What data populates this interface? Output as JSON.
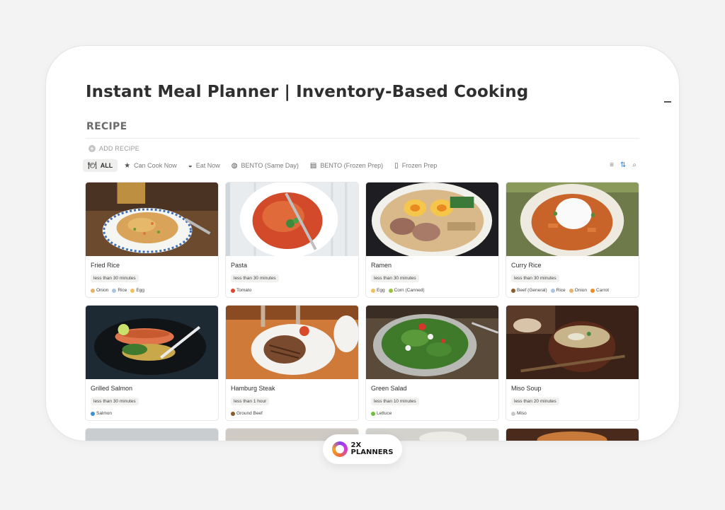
{
  "header": {
    "title": "Instant Meal Planner | Inventory-Based Cooking",
    "section": "RECIPE",
    "add_label": "ADD RECIPE"
  },
  "tabs": [
    {
      "label": "ALL",
      "icon": "utensils-icon",
      "active": true
    },
    {
      "label": "Can Cook Now",
      "icon": "star-icon",
      "active": false
    },
    {
      "label": "Eat Now",
      "icon": "bowl-icon",
      "active": false
    },
    {
      "label": "BENTO (Same Day)",
      "icon": "bento-icon",
      "active": false
    },
    {
      "label": "BENTO (Frozen Prep)",
      "icon": "box-icon",
      "active": false
    },
    {
      "label": "Frozen Prep",
      "icon": "freezer-icon",
      "active": false
    }
  ],
  "tools": [
    "filter-icon",
    "sort-icon",
    "search-icon"
  ],
  "recipes": [
    {
      "name": "Fried Rice",
      "time": "less than 30 minutes",
      "ingredients": [
        {
          "label": "Onion",
          "color": "#e8b26a"
        },
        {
          "label": "Rice",
          "color": "#a9c5e0"
        },
        {
          "label": "Egg",
          "color": "#f0c060"
        }
      ]
    },
    {
      "name": "Pasta",
      "time": "less than 30 minutes",
      "ingredients": [
        {
          "label": "Tomato",
          "color": "#e0432f"
        }
      ]
    },
    {
      "name": "Ramen",
      "time": "less than 30 minutes",
      "ingredients": [
        {
          "label": "Egg",
          "color": "#f0c060"
        },
        {
          "label": "Corn (Canned)",
          "color": "#9bc23b"
        }
      ]
    },
    {
      "name": "Curry Rice",
      "time": "less than 30 minutes",
      "ingredients": [
        {
          "label": "Beef (General)",
          "color": "#8a5a2b"
        },
        {
          "label": "Rice",
          "color": "#a9c5e0"
        },
        {
          "label": "Onion",
          "color": "#e8b26a"
        },
        {
          "label": "Carrot",
          "color": "#f08a24"
        }
      ]
    },
    {
      "name": "Grilled Salmon",
      "time": "less than 30 minutes",
      "ingredients": [
        {
          "label": "Salmon",
          "color": "#3a8fd0"
        }
      ]
    },
    {
      "name": "Hamburg Steak",
      "time": "less than 1 hour",
      "ingredients": [
        {
          "label": "Ground Beef",
          "color": "#8a5a2b"
        }
      ]
    },
    {
      "name": "Green Salad",
      "time": "less than 10 minutes",
      "ingredients": [
        {
          "label": "Lettuce",
          "color": "#6fbf3f"
        }
      ]
    },
    {
      "name": "Miso Soup",
      "time": "less than 20 minutes",
      "ingredients": [
        {
          "label": "Miso",
          "color": "#c9c9c9"
        }
      ]
    }
  ],
  "logo": {
    "line1": "2X",
    "line2": "PLANNERS"
  }
}
